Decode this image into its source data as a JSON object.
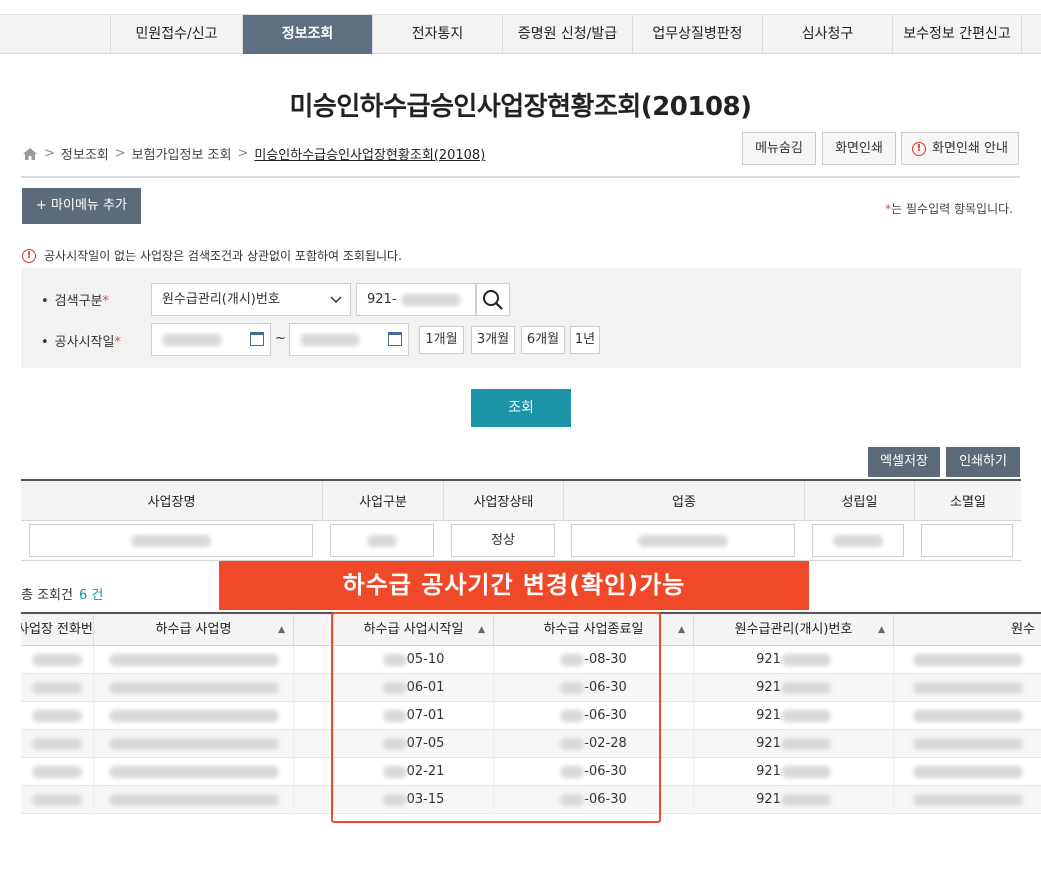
{
  "nav": {
    "items": [
      "민원접수/신고",
      "정보조회",
      "전자통지",
      "증명원 신청/발급",
      "업무상질병판정",
      "심사청구",
      "보수정보 간편신고"
    ],
    "active_index": 1
  },
  "page_title": "미승인하수급승인사업장현황조회(20108)",
  "breadcrumb": {
    "home_icon": "home-icon",
    "items": [
      "정보조회",
      "보험가입정보 조회",
      "미승인하수급승인사업장현황조회(20108)"
    ]
  },
  "top_buttons": {
    "hide_menu": "메뉴숨김",
    "print": "화면인쇄",
    "print_guide": "화면인쇄 안내"
  },
  "my_menu_button": "+ 마이메뉴 추가",
  "required_note": {
    "star": "*",
    "text": "는 필수입력 항목입니다."
  },
  "notice": "공사시작일이 없는 사업장은 검색조건과 상관없이 포함하여 조회됩니다.",
  "search": {
    "type_label": "검색구분",
    "type_value": "원수급관리(개시)번호",
    "number_value": "921-",
    "date_label": "공사시작일",
    "tilde": "~",
    "period_buttons": [
      "1개월",
      "3개월",
      "6개월",
      "1년"
    ]
  },
  "search_button": "조회",
  "excel_button": "엑셀저장",
  "print_button": "인쇄하기",
  "summary_table": {
    "headers": [
      "사업장명",
      "사업구분",
      "사업장상태",
      "업종",
      "성립일",
      "소멸일"
    ],
    "status_value": "정상"
  },
  "total": {
    "label": "총 조회건",
    "count": "6 건"
  },
  "banner": "하수급 공사기간 변경(확인)가능",
  "list_table": {
    "headers": [
      "사업장 전화번호",
      "하수급 사업명",
      "",
      "하수급 사업시작일",
      "하수급 사업종료일",
      "원수급관리(개시)번호",
      "원수"
    ],
    "rows": [
      {
        "start": "05-10",
        "end": "-08-30",
        "no": "921"
      },
      {
        "start": "06-01",
        "end": "-06-30",
        "no": "921"
      },
      {
        "start": "07-01",
        "end": "-06-30",
        "no": "921"
      },
      {
        "start": "07-05",
        "end": "-02-28",
        "no": "921"
      },
      {
        "start": "02-21",
        "end": "-06-30",
        "no": "921"
      },
      {
        "start": "03-15",
        "end": "-06-30",
        "no": "921"
      }
    ]
  },
  "colors": {
    "nav_active": "#5d6f80",
    "accent": "#1a94a6",
    "highlight": "#f0492a"
  }
}
